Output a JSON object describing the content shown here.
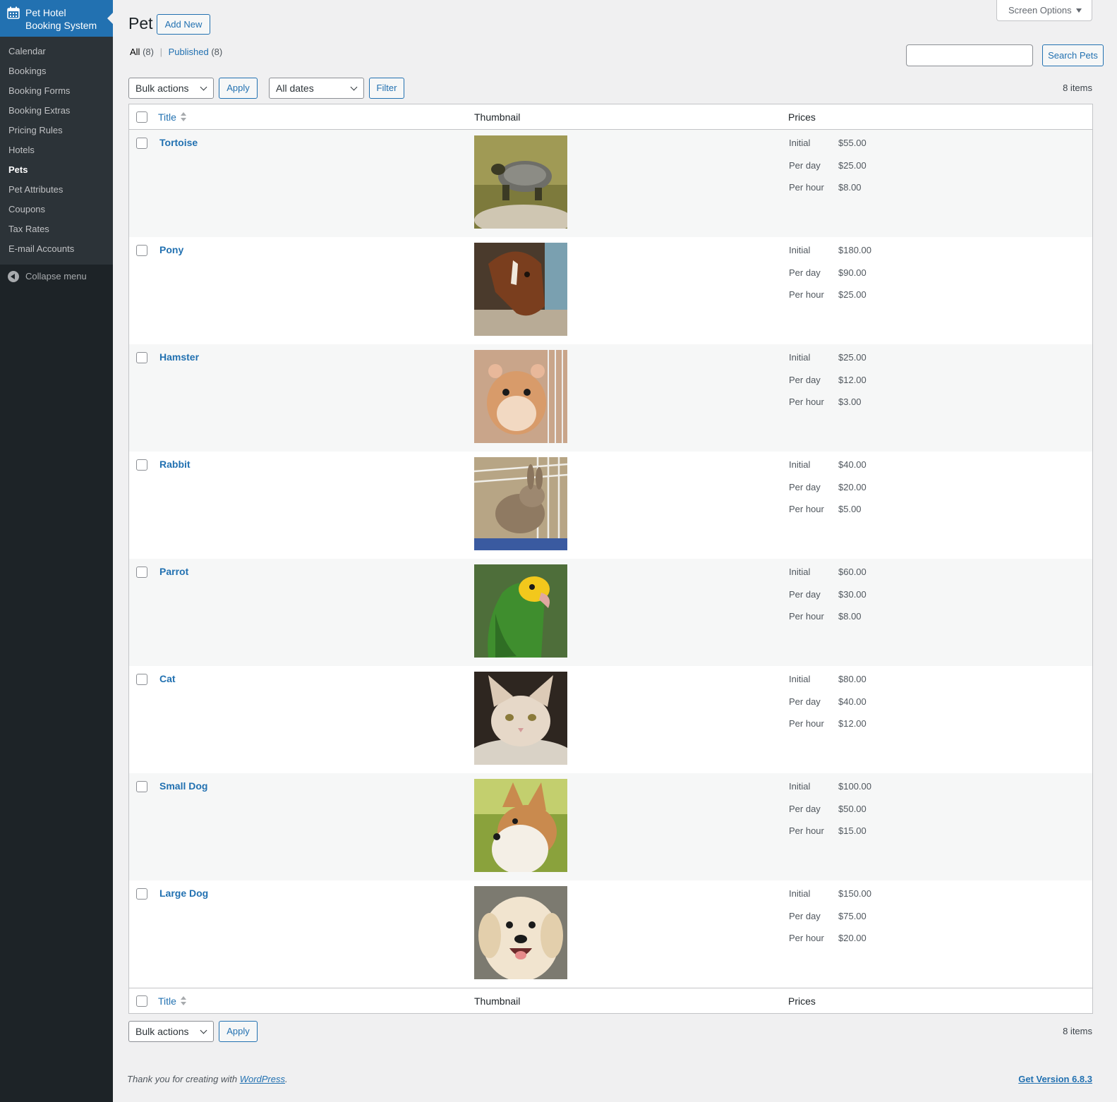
{
  "sidebar": {
    "brand": "Pet Hotel Booking System",
    "brand_line1": "Pet Hotel",
    "brand_line2": "Booking System",
    "items": [
      {
        "label": "Calendar"
      },
      {
        "label": "Bookings"
      },
      {
        "label": "Booking Forms"
      },
      {
        "label": "Booking Extras"
      },
      {
        "label": "Pricing Rules"
      },
      {
        "label": "Hotels"
      },
      {
        "label": "Pets"
      },
      {
        "label": "Pet Attributes"
      },
      {
        "label": "Coupons"
      },
      {
        "label": "Tax Rates"
      },
      {
        "label": "E-mail Accounts"
      }
    ],
    "current": "Pets",
    "collapse_label": "Collapse menu"
  },
  "header": {
    "screen_options": "Screen Options",
    "title": "Pet",
    "add_new": "Add New"
  },
  "views": {
    "all_label": "All",
    "all_count": "(8)",
    "published_label": "Published",
    "published_count": "(8)"
  },
  "search": {
    "value": "",
    "button": "Search Pets"
  },
  "toolbar": {
    "bulk_actions": "Bulk actions",
    "apply": "Apply",
    "dates": "All dates",
    "filter": "Filter",
    "items_count": "8 items"
  },
  "table": {
    "columns": {
      "title": "Title",
      "thumbnail": "Thumbnail",
      "prices": "Prices"
    },
    "price_labels": {
      "initial": "Initial",
      "per_day": "Per day",
      "per_hour": "Per hour"
    },
    "rows": [
      {
        "title": "Tortoise",
        "initial": "$55.00",
        "per_day": "$25.00",
        "per_hour": "$8.00",
        "thumb_icon": "tortoise-photo"
      },
      {
        "title": "Pony",
        "initial": "$180.00",
        "per_day": "$90.00",
        "per_hour": "$25.00",
        "thumb_icon": "pony-photo"
      },
      {
        "title": "Hamster",
        "initial": "$25.00",
        "per_day": "$12.00",
        "per_hour": "$3.00",
        "thumb_icon": "hamster-photo"
      },
      {
        "title": "Rabbit",
        "initial": "$40.00",
        "per_day": "$20.00",
        "per_hour": "$5.00",
        "thumb_icon": "rabbit-photo"
      },
      {
        "title": "Parrot",
        "initial": "$60.00",
        "per_day": "$30.00",
        "per_hour": "$8.00",
        "thumb_icon": "parrot-photo"
      },
      {
        "title": "Cat",
        "initial": "$80.00",
        "per_day": "$40.00",
        "per_hour": "$12.00",
        "thumb_icon": "cat-photo"
      },
      {
        "title": "Small Dog",
        "initial": "$100.00",
        "per_day": "$50.00",
        "per_hour": "$15.00",
        "thumb_icon": "small-dog-photo"
      },
      {
        "title": "Large Dog",
        "initial": "$150.00",
        "per_day": "$75.00",
        "per_hour": "$20.00",
        "thumb_icon": "large-dog-photo"
      }
    ]
  },
  "footer": {
    "thanks_prefix": "Thank you for creating with",
    "wordpress_link": "WordPress",
    "thanks_suffix": ".",
    "version": "Get Version 6.8.3"
  },
  "colors": {
    "sidebar_bg": "#1d2327",
    "submenu_bg": "#2c3338",
    "brand_bg": "#2271b1",
    "link": "#2271b1",
    "page_bg": "#f0f0f1",
    "row_alt": "#f6f7f7"
  }
}
